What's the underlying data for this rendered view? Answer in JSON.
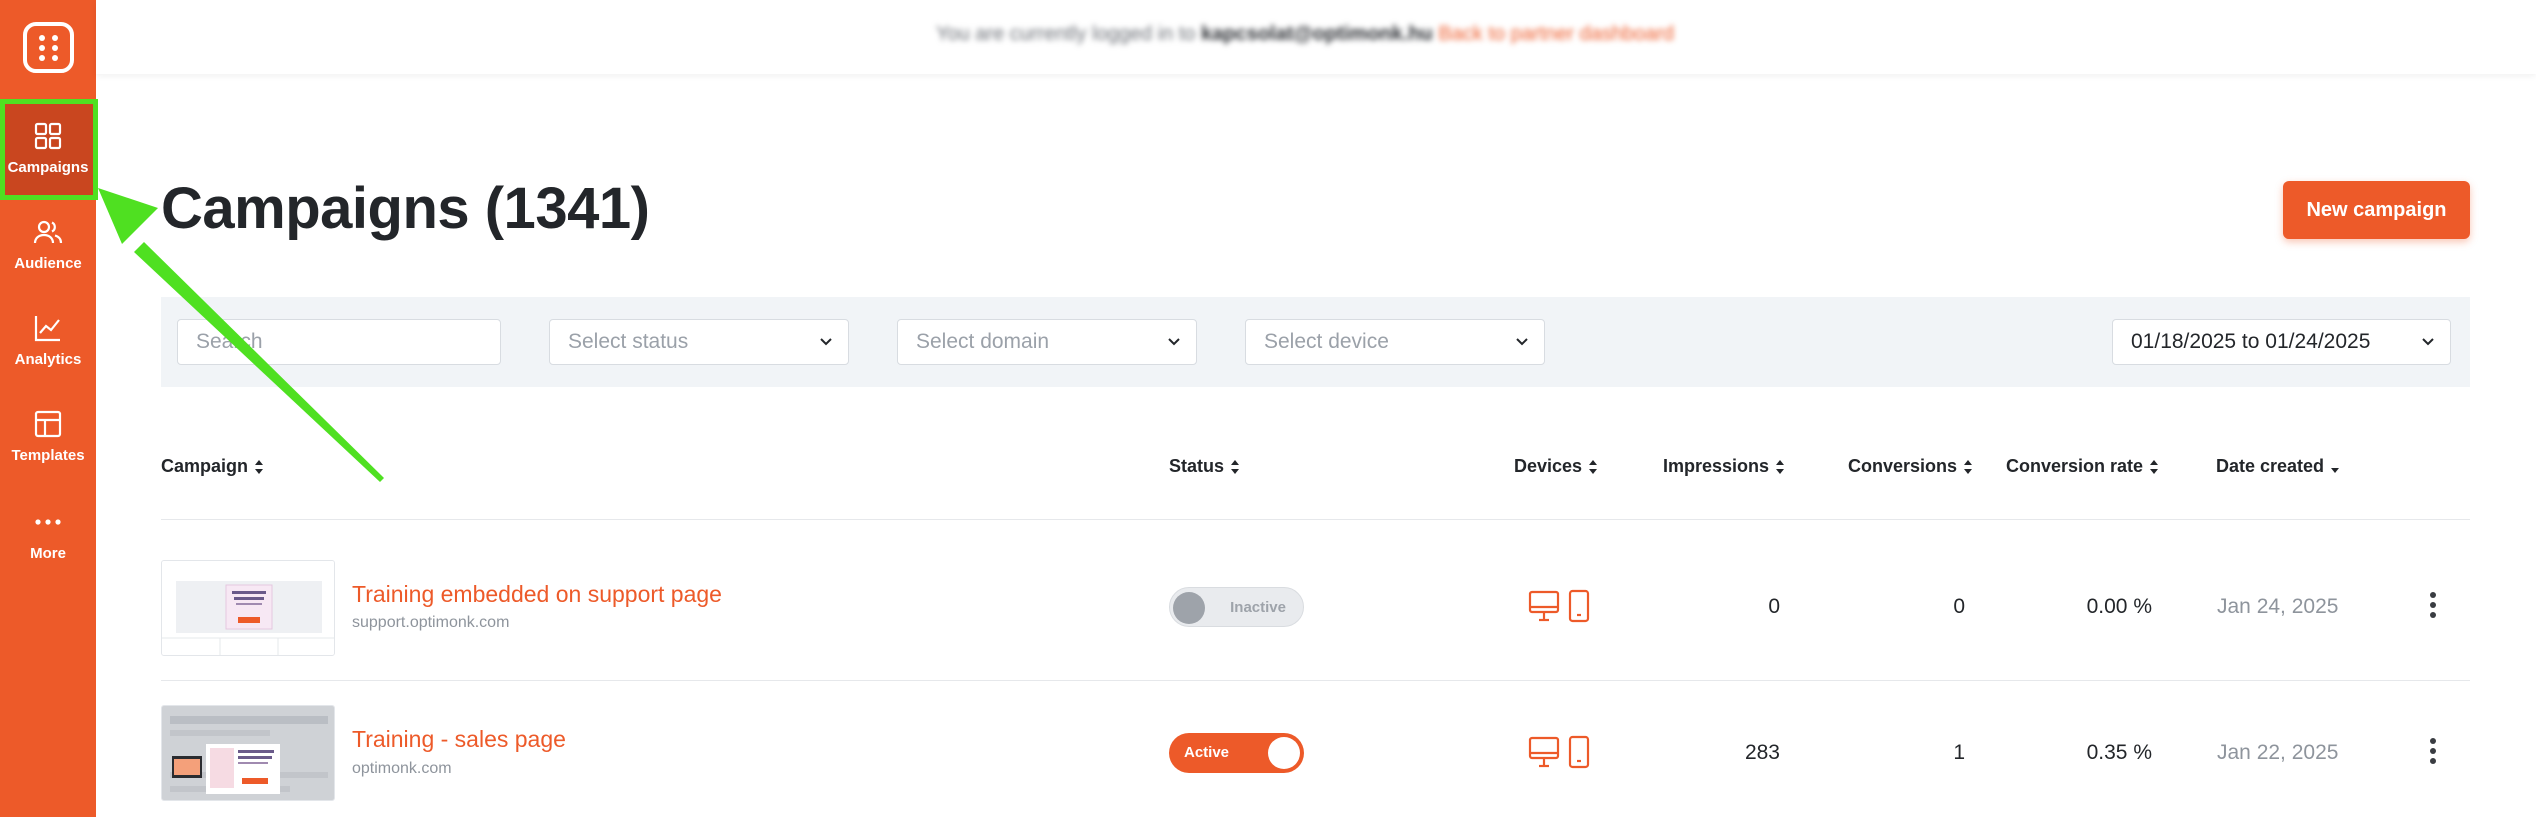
{
  "sidebar": {
    "items": [
      {
        "label": "Campaigns",
        "icon": "grid-icon",
        "active": true
      },
      {
        "label": "Audience",
        "icon": "users-icon"
      },
      {
        "label": "Analytics",
        "icon": "chart-icon"
      },
      {
        "label": "Templates",
        "icon": "layout-icon"
      },
      {
        "label": "More",
        "icon": "more-dots-icon"
      }
    ]
  },
  "topbar": {
    "prefix": "You are currently logged in to",
    "email": "kapcsolat@optimonk.hu",
    "link": "Back to partner dashboard"
  },
  "header": {
    "title": "Campaigns (1341)",
    "new_button": "New campaign"
  },
  "filters": {
    "search_placeholder": "Search",
    "status_placeholder": "Select status",
    "domain_placeholder": "Select domain",
    "device_placeholder": "Select device",
    "date_range": "01/18/2025 to 01/24/2025"
  },
  "table": {
    "columns": {
      "campaign": "Campaign",
      "status": "Status",
      "devices": "Devices",
      "impressions": "Impressions",
      "conversions": "Conversions",
      "conversion_rate": "Conversion rate",
      "date_created": "Date created"
    },
    "rows": [
      {
        "name": "Training embedded on support page",
        "domain": "support.optimonk.com",
        "status": "Inactive",
        "impressions": "0",
        "conversions": "0",
        "conversion_rate": "0.00 %",
        "date_created": "Jan 24, 2025"
      },
      {
        "name": "Training - sales page",
        "domain": "optimonk.com",
        "status": "Active",
        "impressions": "283",
        "conversions": "1",
        "conversion_rate": "0.35 %",
        "date_created": "Jan 22, 2025"
      }
    ]
  },
  "colors": {
    "brand": "#ed5a29",
    "highlight": "#4fe021"
  }
}
